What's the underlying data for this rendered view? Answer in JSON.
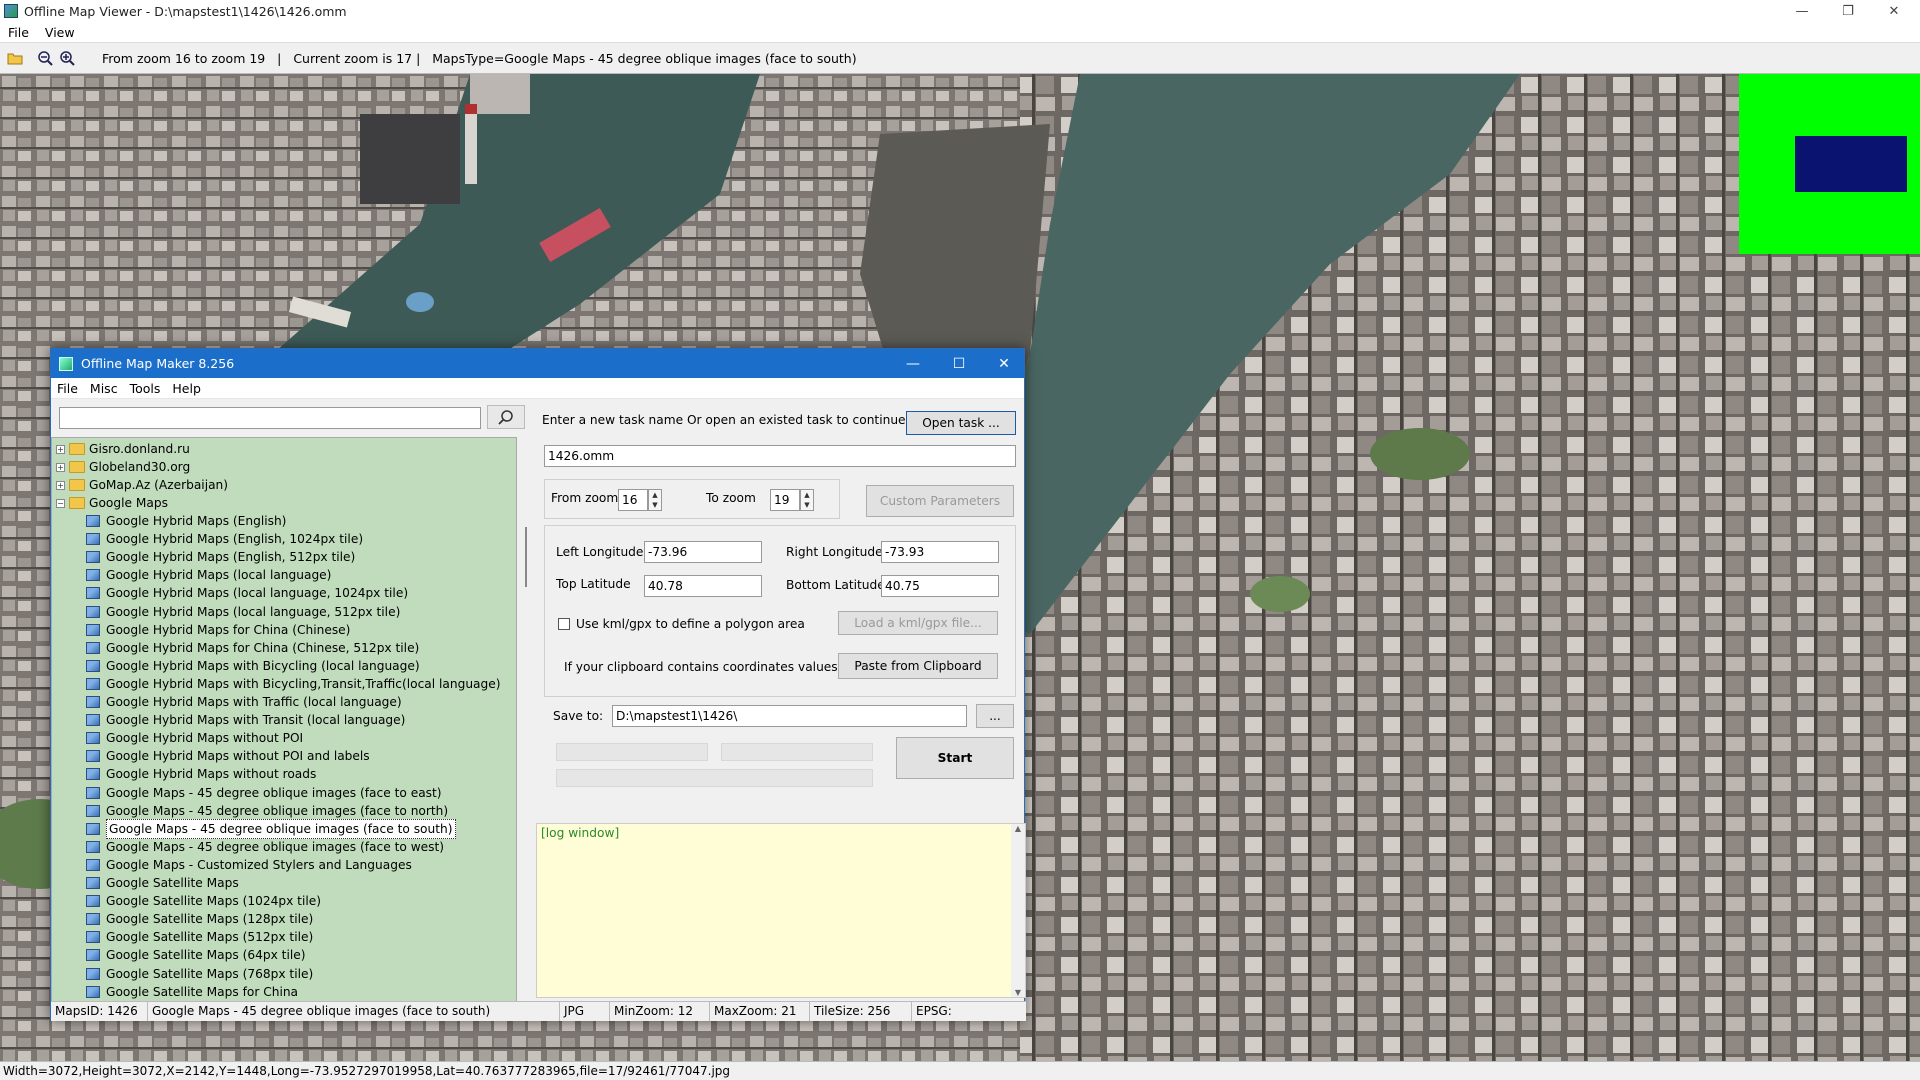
{
  "window": {
    "title": "Offline Map Viewer - D:\\mapstest1\\1426\\1426.omm",
    "menu": [
      "File",
      "View"
    ],
    "controls": [
      "—",
      "❐",
      "✕"
    ]
  },
  "toolbar": {
    "info": "From zoom 16 to zoom 19   |   Current zoom is 17 |   MapsType=Google Maps - 45 degree oblique images (face to south)"
  },
  "status_bar": "Width=3072,Height=3072,X=2142,Y=1448,Long=-73.9527297019958,Lat=40.763777283965,file=17/92461/77047.jpg",
  "dialog": {
    "title": "Offline Map Maker 8.256",
    "menu": [
      "File",
      "Misc",
      "Tools",
      "Help"
    ],
    "search_value": "",
    "tree": {
      "folders": [
        {
          "label": "Gisro.donland.ru",
          "expanded": false
        },
        {
          "label": "Globeland30.org",
          "expanded": false
        },
        {
          "label": "GoMap.Az (Azerbaijan)",
          "expanded": false
        },
        {
          "label": "Google Maps",
          "expanded": true
        }
      ],
      "items": [
        "Google Hybrid Maps (English)",
        "Google Hybrid Maps (English, 1024px tile)",
        "Google Hybrid Maps (English, 512px tile)",
        "Google Hybrid Maps (local language)",
        "Google Hybrid Maps (local language, 1024px tile)",
        "Google Hybrid Maps (local language, 512px tile)",
        "Google Hybrid Maps for China (Chinese)",
        "Google Hybrid Maps for China (Chinese, 512px tile)",
        "Google Hybrid Maps with Bicycling (local language)",
        "Google Hybrid Maps with Bicycling,Transit,Traffic(local language)",
        "Google Hybrid Maps with Traffic (local language)",
        "Google Hybrid Maps with Transit (local language)",
        "Google Hybrid Maps without POI",
        "Google Hybrid Maps without POI and labels",
        "Google Hybrid Maps without roads",
        "Google Maps - 45 degree oblique images (face to east)",
        "Google Maps - 45 degree oblique images (face to north)",
        "Google Maps - 45 degree oblique images (face to south)",
        "Google Maps - 45 degree oblique images (face to west)",
        "Google Maps - Customized Stylers and Languages",
        "Google Satellite Maps",
        "Google Satellite Maps (1024px tile)",
        "Google Satellite Maps (128px tile)",
        "Google Satellite Maps (512px tile)",
        "Google Satellite Maps (64px tile)",
        "Google Satellite Maps (768px tile)",
        "Google Satellite Maps for China"
      ],
      "selected_index": 17
    },
    "task_prompt": "Enter a new task name Or open an existed task to continue:",
    "open_task_label": "Open task ...",
    "task_name": "1426.omm",
    "from_zoom_label": "From zoom",
    "from_zoom": "16",
    "to_zoom_label": "To zoom",
    "to_zoom": "19",
    "custom_params_label": "Custom Parameters",
    "left_lon_label": "Left Longitude",
    "left_lon": "-73.96",
    "right_lon_label": "Right Longitude",
    "right_lon": "-73.93",
    "top_lat_label": "Top Latitude",
    "top_lat": "40.78",
    "bottom_lat_label": "Bottom Latitude",
    "bottom_lat": "40.75",
    "kml_label": "Use kml/gpx to define a polygon area",
    "load_kml_label": "Load a kml/gpx file...",
    "clipboard_label": "If your clipboard contains coordinates values:",
    "paste_label": "Paste from Clipboard",
    "save_to_label": "Save to:",
    "save_to": "D:\\mapstest1\\1426\\",
    "browse_label": "...",
    "start_label": "Start",
    "log_text": "[log window]",
    "status": {
      "maps_id": "MapsID: 1426",
      "maps_name": "Google Maps - 45 degree oblique images (face to south)",
      "format": "JPG",
      "min_zoom": "MinZoom: 12",
      "max_zoom": "MaxZoom: 21",
      "tile_size": "TileSize: 256",
      "epsg": "EPSG:"
    }
  },
  "colors": {
    "tree_bg": "#c0dcbc",
    "dialog_title": "#1b6fcb",
    "log_bg": "#fffdd6",
    "overview_bg": "#00ff00",
    "overview_rect": "#0a1470"
  }
}
